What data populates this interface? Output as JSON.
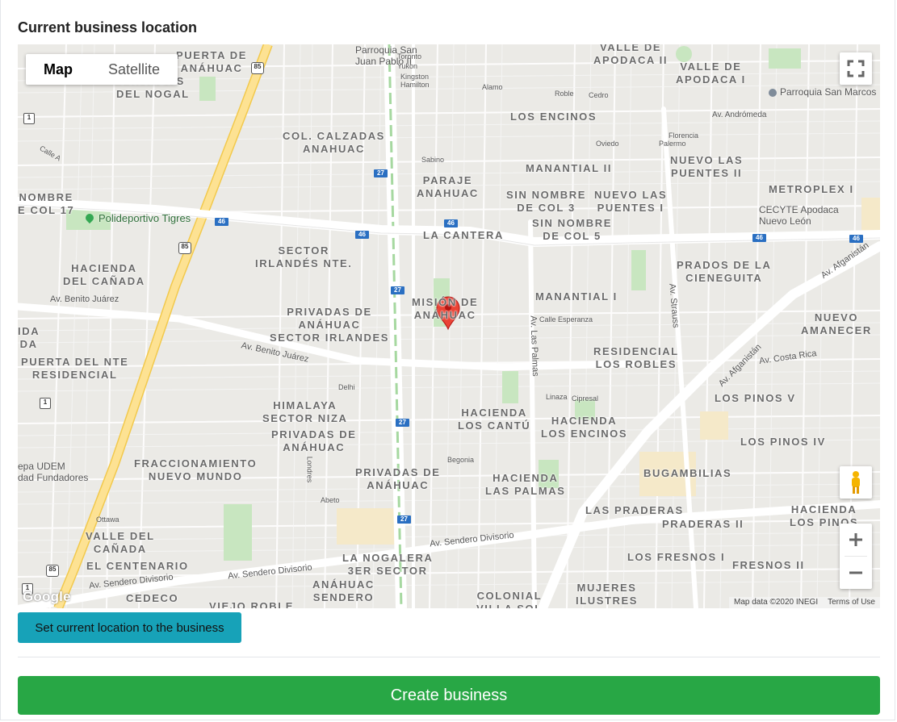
{
  "section_title": "Current business location",
  "map": {
    "type_control": {
      "map": "Map",
      "satellite": "Satellite",
      "active": "Map"
    },
    "attribution": {
      "data": "Map data ©2020 INEGI",
      "terms": "Terms of Use"
    },
    "logo": "Google",
    "area_labels": [
      "PUERTA DE\nANÁHUAC",
      "PRIVADAS\nDEL NOGAL",
      "COL. CALZADAS\nANAHUAC",
      "PARAJE\nANAHUAC",
      "VALLE DE\nAPODACA II",
      "VALLE DE\nAPODACA I",
      "LOS ENCINOS",
      "MANANTIAL II",
      "NUEVO LAS\nPUENTES II",
      "SIN NOMBRE\nDE COL 3",
      "NUEVO LAS\nPUENTES I",
      "METROPLEX I",
      "SIN NOMBRE\nDE COL 5",
      "LA CANTERA",
      "SECTOR\nIRLANDÉS NTE.",
      "HACIENDA\nDEL CAÑADA",
      "PRADOS DE LA\nCIENEGUITA",
      "MISIÓN DE\nANÁHUAC",
      "PRIVADAS DE\nANÁHUAC\nSECTOR IRLANDES",
      "MANANTIAL I",
      "NUEVO\nAMANECER",
      "RESIDENCIAL\nLOS ROBLES",
      "PUERTA DEL NTE\nRESIDENCIAL",
      "HIMALAYA\nSECTOR NIZA",
      "PRIVADAS DE\nANÁHUAC",
      "HACIENDA\nLOS CANTÚ",
      "HACIENDA\nLOS ENCINOS",
      "LOS PINOS V",
      "LOS PINOS IV",
      "FRACCIONAMIENTO\nNUEVO MUNDO",
      "PRIVADAS DE\nANÁHUAC",
      "HACIENDA\nLAS PALMAS",
      "BUGAMBILIAS",
      "LAS PRADERAS",
      "HACIENDA\nLOS PINOS",
      "PRADERAS II",
      "VALLE DEL\nCAÑADA",
      "EL CENTENARIO",
      "LA NOGALERA\n3ER SECTOR",
      "LOS FRESNOS I",
      "FRESNOS II",
      "CEDECO",
      "VIEJO ROBLE",
      "ANÁHUAC\nSENDERO",
      "COLONIAL\nVILLA SOL",
      "MUJERES\nILUSTRES",
      "NOMBRE\nE COL 17",
      "IDA\nDA"
    ],
    "pois": [
      "Polideportivo Tigres",
      "Parroquia San\nJuan Pablo II",
      "Parroquia San Marcos",
      "CECYTE Apodaca\nNuevo León",
      "epa UDEM\ndad Fundadores"
    ],
    "streets": [
      "Av. Benito Juárez",
      "Av. Benito Juárez",
      "Av. Sendero Divisorio",
      "Av. Sendero Divisorio",
      "Av. Sendero Divisorio",
      "Av. Afganistán",
      "Av. Afganistán",
      "Av. Costa Rica",
      "Av. Las Palmas",
      "Av. Strauss",
      "Av. Andrómeda",
      "Calle A",
      "Calle Esperanza",
      "Linaza",
      "Cipresal",
      "Begonia",
      "Abeto",
      "Delhi",
      "Londres",
      "Ottawa",
      "Alamo",
      "Roble",
      "Cedro",
      "Sabino",
      "Palermo",
      "Florencia",
      "Oviedo",
      "Toronto",
      "Yukon",
      "Kingston",
      "Hamilton"
    ],
    "highways": [
      "85",
      "85",
      "85",
      "27",
      "27",
      "27",
      "27",
      "27",
      "46",
      "46",
      "46",
      "46",
      "46",
      "1",
      "1",
      "1"
    ]
  },
  "buttons": {
    "set_location": "Set current location to the business",
    "create": "Create business"
  },
  "colors": {
    "info_button": "#17a2b8",
    "success_button": "#28a745",
    "marker": "#ea4335",
    "highway": "#fde293",
    "park": "#c8e6c0"
  }
}
